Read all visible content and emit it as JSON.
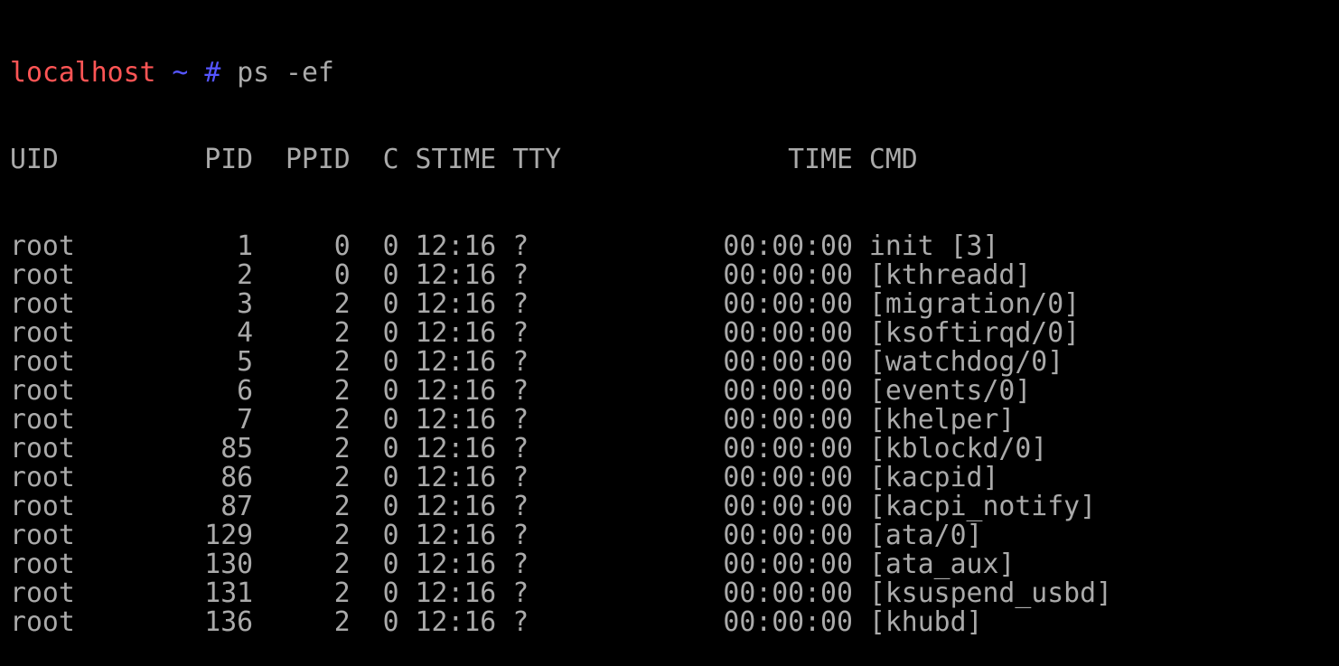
{
  "colors": {
    "background": "#000000",
    "text": "#aaaaaa",
    "prompt_host": "#ff5555",
    "prompt_path": "#5555ff"
  },
  "prompt": {
    "host": "localhost",
    "path": "~",
    "symbol": "#",
    "command": "ps -ef"
  },
  "table": {
    "columns": [
      "UID",
      "PID",
      "PPID",
      "C",
      "STIME",
      "TTY",
      "TIME",
      "CMD"
    ],
    "rows": [
      {
        "uid": "root",
        "pid": "1",
        "ppid": "0",
        "c": "0",
        "stime": "12:16",
        "tty": "?",
        "time": "00:00:00",
        "cmd": "init [3]"
      },
      {
        "uid": "root",
        "pid": "2",
        "ppid": "0",
        "c": "0",
        "stime": "12:16",
        "tty": "?",
        "time": "00:00:00",
        "cmd": "[kthreadd]"
      },
      {
        "uid": "root",
        "pid": "3",
        "ppid": "2",
        "c": "0",
        "stime": "12:16",
        "tty": "?",
        "time": "00:00:00",
        "cmd": "[migration/0]"
      },
      {
        "uid": "root",
        "pid": "4",
        "ppid": "2",
        "c": "0",
        "stime": "12:16",
        "tty": "?",
        "time": "00:00:00",
        "cmd": "[ksoftirqd/0]"
      },
      {
        "uid": "root",
        "pid": "5",
        "ppid": "2",
        "c": "0",
        "stime": "12:16",
        "tty": "?",
        "time": "00:00:00",
        "cmd": "[watchdog/0]"
      },
      {
        "uid": "root",
        "pid": "6",
        "ppid": "2",
        "c": "0",
        "stime": "12:16",
        "tty": "?",
        "time": "00:00:00",
        "cmd": "[events/0]"
      },
      {
        "uid": "root",
        "pid": "7",
        "ppid": "2",
        "c": "0",
        "stime": "12:16",
        "tty": "?",
        "time": "00:00:00",
        "cmd": "[khelper]"
      },
      {
        "uid": "root",
        "pid": "85",
        "ppid": "2",
        "c": "0",
        "stime": "12:16",
        "tty": "?",
        "time": "00:00:00",
        "cmd": "[kblockd/0]"
      },
      {
        "uid": "root",
        "pid": "86",
        "ppid": "2",
        "c": "0",
        "stime": "12:16",
        "tty": "?",
        "time": "00:00:00",
        "cmd": "[kacpid]"
      },
      {
        "uid": "root",
        "pid": "87",
        "ppid": "2",
        "c": "0",
        "stime": "12:16",
        "tty": "?",
        "time": "00:00:00",
        "cmd": "[kacpi_notify]"
      },
      {
        "uid": "root",
        "pid": "129",
        "ppid": "2",
        "c": "0",
        "stime": "12:16",
        "tty": "?",
        "time": "00:00:00",
        "cmd": "[ata/0]"
      },
      {
        "uid": "root",
        "pid": "130",
        "ppid": "2",
        "c": "0",
        "stime": "12:16",
        "tty": "?",
        "time": "00:00:00",
        "cmd": "[ata_aux]"
      },
      {
        "uid": "root",
        "pid": "131",
        "ppid": "2",
        "c": "0",
        "stime": "12:16",
        "tty": "?",
        "time": "00:00:00",
        "cmd": "[ksuspend_usbd]"
      },
      {
        "uid": "root",
        "pid": "136",
        "ppid": "2",
        "c": "0",
        "stime": "12:16",
        "tty": "?",
        "time": "00:00:00",
        "cmd": "[khubd]"
      }
    ]
  }
}
